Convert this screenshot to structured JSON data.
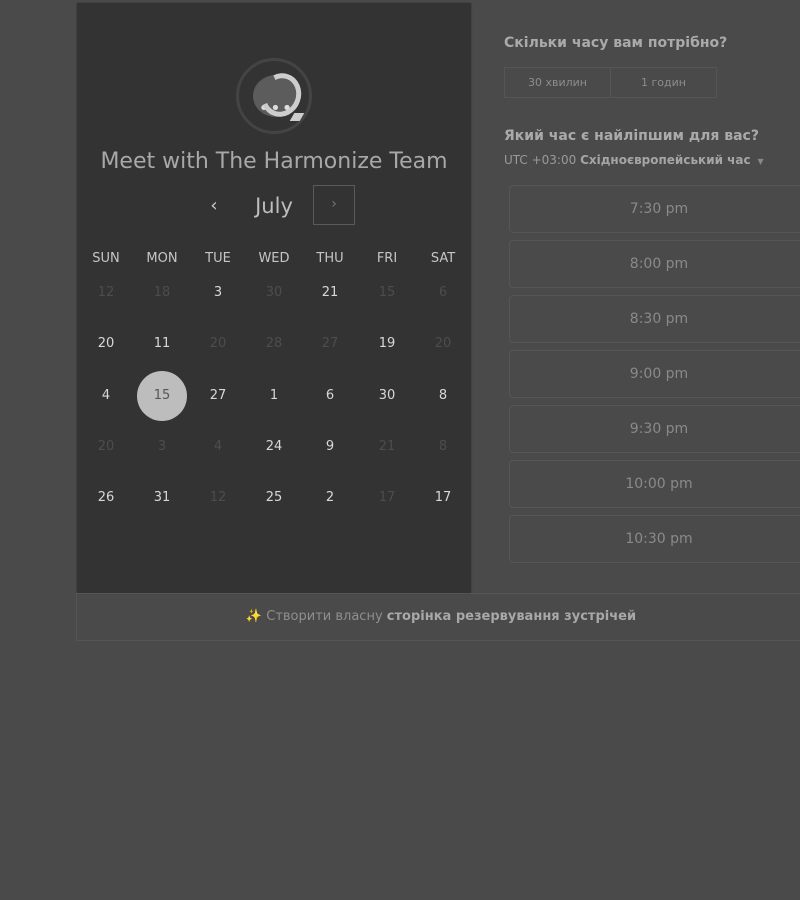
{
  "calendar": {
    "title": "Meet with The Harmonize Team",
    "month": "July",
    "nav": {
      "prev": "‹",
      "next": "›"
    },
    "weekdays": [
      "SUN",
      "MON",
      "TUE",
      "WED",
      "THU",
      "FRI",
      "SAT"
    ],
    "rows": [
      [
        {
          "d": "12",
          "dim": true
        },
        {
          "d": "18",
          "dim": true
        },
        {
          "d": "3",
          "dim": false
        },
        {
          "d": "30",
          "dim": true
        },
        {
          "d": "21",
          "dim": false
        },
        {
          "d": "15",
          "dim": true
        },
        {
          "d": "6",
          "dim": true
        }
      ],
      [
        {
          "d": "20",
          "dim": false
        },
        {
          "d": "11",
          "dim": false
        },
        {
          "d": "20",
          "dim": true
        },
        {
          "d": "28",
          "dim": true
        },
        {
          "d": "27",
          "dim": true
        },
        {
          "d": "19",
          "dim": false
        },
        {
          "d": "20",
          "dim": true
        }
      ],
      [
        {
          "d": "4",
          "dim": false
        },
        {
          "d": "15",
          "dim": false,
          "selected": true
        },
        {
          "d": "27",
          "dim": false
        },
        {
          "d": "1",
          "dim": false
        },
        {
          "d": "6",
          "dim": false
        },
        {
          "d": "30",
          "dim": false
        },
        {
          "d": "8",
          "dim": false
        }
      ],
      [
        {
          "d": "20",
          "dim": true
        },
        {
          "d": "3",
          "dim": true
        },
        {
          "d": "4",
          "dim": true
        },
        {
          "d": "24",
          "dim": false
        },
        {
          "d": "9",
          "dim": false
        },
        {
          "d": "21",
          "dim": true
        },
        {
          "d": "8",
          "dim": true
        }
      ],
      [
        {
          "d": "26",
          "dim": false
        },
        {
          "d": "31",
          "dim": false
        },
        {
          "d": "12",
          "dim": true
        },
        {
          "d": "25",
          "dim": false
        },
        {
          "d": "2",
          "dim": false
        },
        {
          "d": "17",
          "dim": true
        },
        {
          "d": "17",
          "dim": false
        }
      ]
    ]
  },
  "duration": {
    "question": "Скільки часу вам потрібно?",
    "options": [
      "30 хвилин",
      "1 годин"
    ]
  },
  "time": {
    "question": "Який час є найліпшим для вас?",
    "timezone_offset": "UTC +03:00",
    "timezone_name": "Східноєвропейський час",
    "slots": [
      "7:30 pm",
      "8:00 pm",
      "8:30 pm",
      "9:00 pm",
      "9:30 pm",
      "10:00 pm",
      "10:30 pm"
    ]
  },
  "footer": {
    "prefix": "Створити власну",
    "link": "сторінка резервування зустрічей"
  }
}
